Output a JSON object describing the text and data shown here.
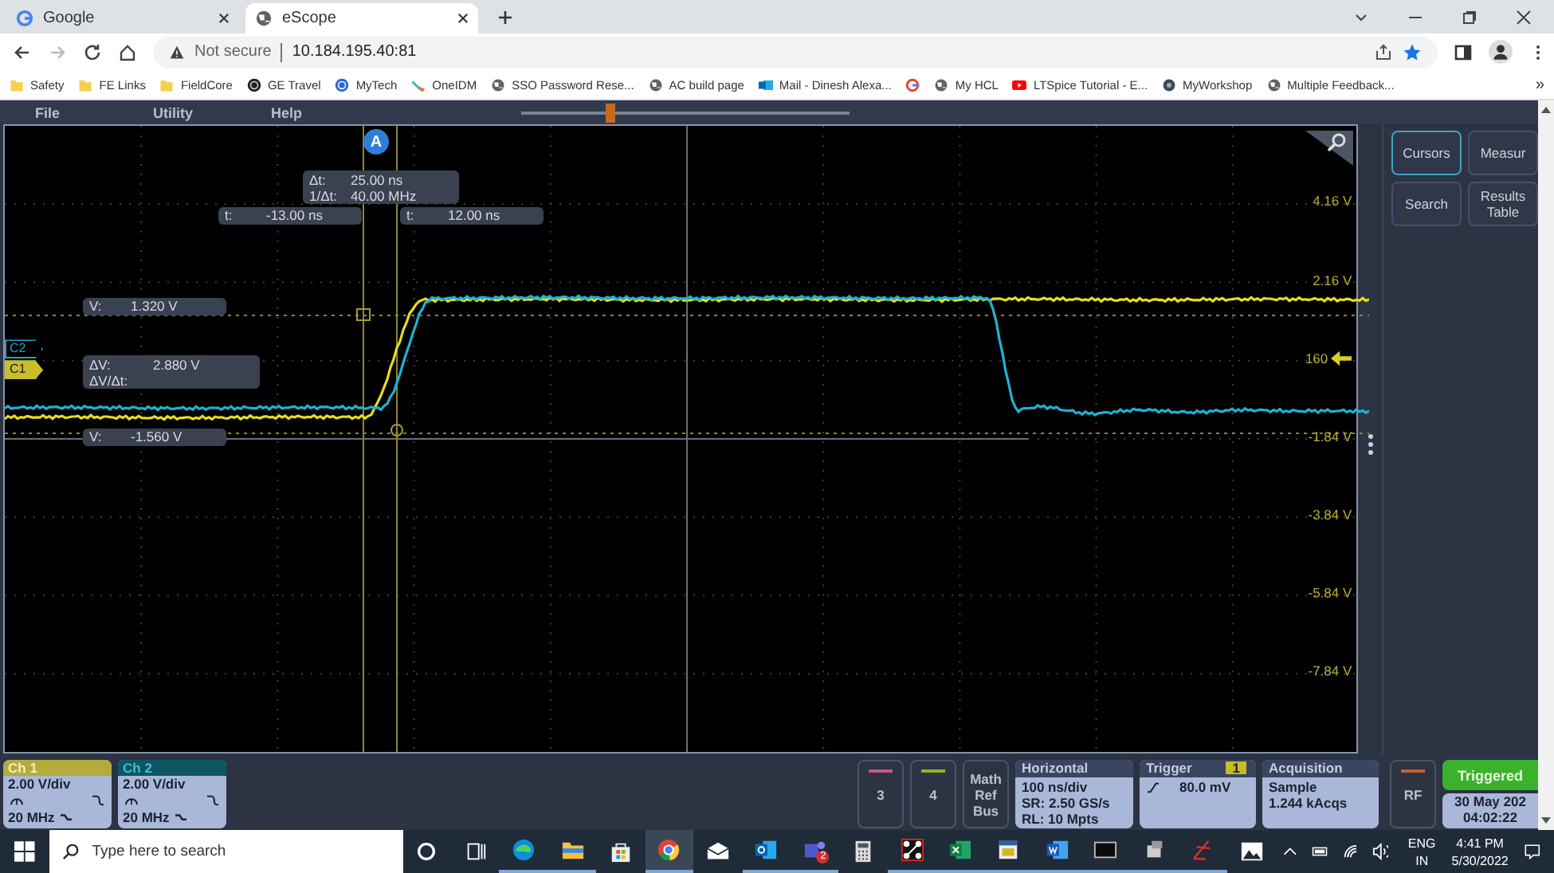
{
  "browser": {
    "tabs": [
      {
        "title": "Google",
        "kind": "google",
        "selected": false
      },
      {
        "title": "eScope",
        "kind": "globe",
        "selected": true
      }
    ],
    "security": "Not secure",
    "url": "10.184.195.40:81",
    "bookmarks": [
      {
        "label": "Safety",
        "kind": "folder"
      },
      {
        "label": "FE Links",
        "kind": "folder"
      },
      {
        "label": "FieldCore",
        "kind": "folder"
      },
      {
        "label": "GE Travel",
        "kind": "ge-dark"
      },
      {
        "label": "MyTech",
        "kind": "ge"
      },
      {
        "label": "OneIDM",
        "kind": "idm"
      },
      {
        "label": "SSO Password Rese...",
        "kind": "globe"
      },
      {
        "label": "AC build page",
        "kind": "globe"
      },
      {
        "label": "Mail - Dinesh Alexa...",
        "kind": "outlook"
      },
      {
        "kind": "google"
      },
      {
        "label": "My HCL",
        "kind": "globe"
      },
      {
        "label": "LTSpice Tutorial - E...",
        "kind": "youtube"
      },
      {
        "label": "MyWorkshop",
        "kind": "gear"
      },
      {
        "label": "Multiple Feedback...",
        "kind": "globe"
      }
    ],
    "overflow": "»"
  },
  "scope": {
    "menu": [
      "File",
      "Utility",
      "Help"
    ],
    "trigger_position": {
      "level": 0.27
    },
    "scale_labels": [
      {
        "text": "4.16 V",
        "kind": "scale"
      },
      {
        "text": "2.16 V",
        "kind": "scale"
      },
      {
        "text": "160",
        "kind": "trigger"
      },
      {
        "text": "-1.84 V",
        "kind": "scale"
      },
      {
        "text": "-3.84 V",
        "kind": "scale"
      },
      {
        "text": "-5.84 V",
        "kind": "scale"
      },
      {
        "text": "-7.84 V",
        "kind": "scale"
      }
    ],
    "cursor_marker": "A",
    "readouts": {
      "delta_t": {
        "label": "Δt:",
        "value": "25.00 ns"
      },
      "inverse_delta_t": {
        "label": "1/Δt:",
        "value": "40.00 MHz"
      },
      "t1": {
        "label": "t:",
        "value": "-13.00 ns"
      },
      "t2": {
        "label": "t:",
        "value": "12.00 ns"
      },
      "v1": {
        "label": "V:",
        "value": "1.320 V"
      },
      "delta_v": {
        "label": "ΔV:",
        "value": "2.880 V"
      },
      "dv_dt": {
        "label": "ΔV/Δt:"
      },
      "v2": {
        "label": "V:",
        "value": "-1.560 V"
      }
    },
    "channel_tags": [
      {
        "label": "C2",
        "color": "#1aa6bf"
      },
      {
        "label": "C1",
        "color": "#c8be2c"
      }
    ],
    "side_buttons": [
      {
        "label": "Cursors",
        "selected": true
      },
      {
        "label": "Measur",
        "selected": false
      },
      {
        "label": "Search",
        "selected": false
      },
      {
        "label": "Results Table",
        "selected": false
      }
    ],
    "channels": [
      {
        "name": "Ch 1",
        "scale": "2.00 V/div",
        "bandwidth": "20 MHz",
        "color": "#b3ac3c"
      },
      {
        "name": "Ch 2",
        "scale": "2.00 V/div",
        "bandwidth": "20 MHz",
        "color": "#0d5561"
      }
    ],
    "spare_channels": [
      {
        "label": "3",
        "color": "#c85580"
      },
      {
        "label": "4",
        "color": "#8fb526"
      }
    ],
    "math_ref_bus": [
      "Math",
      "Ref",
      "Bus"
    ],
    "horizontal": {
      "title": "Horizontal",
      "lines": [
        "100 ns/div",
        "SR: 2.50 GS/s",
        "RL: 10 Mpts"
      ]
    },
    "trigger": {
      "title": "Trigger",
      "source": "1",
      "level": "80.0 mV"
    },
    "acquisition": {
      "title": "Acquisition",
      "lines": [
        "Sample",
        "1.244 kAcqs"
      ]
    },
    "rf": "RF",
    "status": {
      "label": "Triggered",
      "date": "30 May 202",
      "time": "04:02:22"
    }
  },
  "taskbar": {
    "search_placeholder": "Type here to search",
    "apps": [
      {
        "kind": "cortana",
        "open": false,
        "selected": false
      },
      {
        "kind": "taskview",
        "open": false,
        "selected": false
      },
      {
        "kind": "edge",
        "open": true,
        "selected": false
      },
      {
        "kind": "explorer",
        "open": true,
        "selected": false
      },
      {
        "kind": "store",
        "open": false,
        "selected": false
      },
      {
        "kind": "chrome",
        "open": true,
        "selected": true
      },
      {
        "kind": "mail",
        "open": false,
        "selected": false
      },
      {
        "kind": "outlook",
        "open": true,
        "selected": false
      },
      {
        "kind": "teams",
        "open": true,
        "selected": false,
        "badge": "2"
      },
      {
        "kind": "calculator",
        "open": false,
        "selected": false
      },
      {
        "kind": "nodes",
        "open": true,
        "selected": false
      },
      {
        "kind": "excel",
        "open": true,
        "selected": false
      },
      {
        "kind": "printer",
        "open": true,
        "selected": false
      },
      {
        "kind": "word",
        "open": true,
        "selected": false
      },
      {
        "kind": "terminal",
        "open": true,
        "selected": false
      },
      {
        "kind": "device",
        "open": true,
        "selected": false
      },
      {
        "kind": "sketch",
        "open": true,
        "selected": false
      },
      {
        "kind": "photos",
        "open": false,
        "selected": false
      }
    ],
    "language": [
      "ENG",
      "IN"
    ],
    "time": "4:41 PM",
    "date": "5/30/2022"
  }
}
